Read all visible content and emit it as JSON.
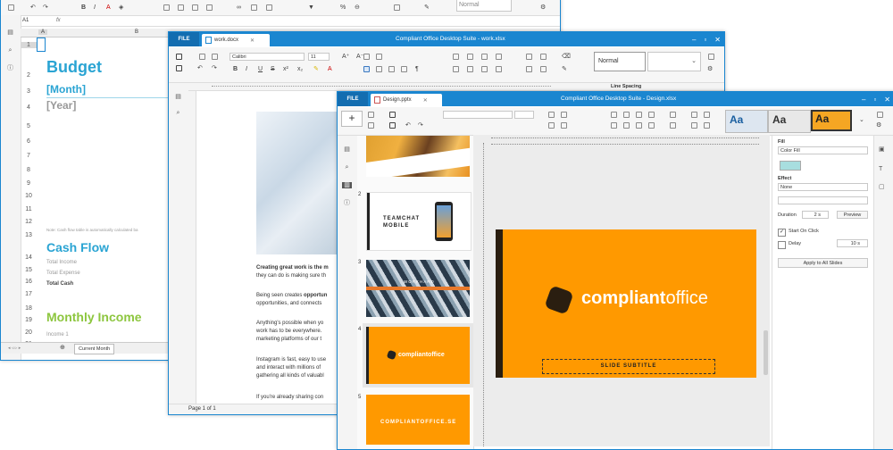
{
  "spreadsheet": {
    "name_box": "A1",
    "formula_prefix": "fx",
    "style_box": "Normal",
    "col_headers": [
      "A",
      "B"
    ],
    "rows": [
      "1",
      "2",
      "3",
      "4",
      "5",
      "6",
      "7",
      "8",
      "9",
      "10",
      "11",
      "12",
      "13",
      "14",
      "15",
      "16",
      "17",
      "18",
      "19",
      "20",
      "21"
    ],
    "title": "Budget",
    "month": "[Month]",
    "year": "[Year]",
    "note": "Note: Cash flow table is automatically calculated ba",
    "cash_flow": "Cash Flow",
    "total_income": "Total Income",
    "total_expense": "Total Expense",
    "total_cash": "Total Cash",
    "monthly_income": "Monthly Income",
    "income_1": "Income 1",
    "sheet_tab": "Current Month"
  },
  "document": {
    "file_label": "FILE",
    "tab_name": "work.docx",
    "window_title": "Compliant Office Desktop Suite - work.xlsx",
    "font_name": "Calibri",
    "font_size": "11",
    "style_name": "Normal",
    "line_spacing_label": "Line Spacing",
    "status": "Page 1 of 1",
    "p1_bold": "Creating great work is the m",
    "p1_rest": "they can do is making sure th",
    "p2_a": "Being seen creates ",
    "p2_b": "opportun",
    "p2_c": "opportunities, and connects",
    "p3_a": "Anything's possible when yo",
    "p3_b": "work has to be everywhere.",
    "p3_c": "marketing platforms of our t",
    "p4_a": "Instagram is fast, easy to use",
    "p4_b": "and interact with millions of",
    "p4_c": "gathering all kinds of valuabl",
    "p5_a": "If you're already sharing con"
  },
  "presentation": {
    "file_label": "FILE",
    "tab_name": "Design.pptx",
    "window_title": "Compliant Office Desktop Suite - Design.xlsx",
    "theme_label": "Aa",
    "slide_numbers": [
      "2",
      "3",
      "4",
      "5"
    ],
    "thumb2_text": "TEAMCHAT\nMOBILE",
    "thumb2_line1": "TEAMCHAT",
    "thumb2_line2": "MOBILE",
    "thumb3_text": "WORKHARD",
    "thumb4_logo": "compliantoffice",
    "thumb5_text": "COMPLIANTOFFICE.SE",
    "slide_logo_a": "compliant",
    "slide_logo_b": "office",
    "slide_subtitle": "SLIDE SUBTITLE",
    "fill_label": "Fill",
    "fill_value": "Color Fill",
    "effect_label": "Effect",
    "effect_value": "None",
    "duration_label": "Duration",
    "duration_value": "2 s",
    "preview_label": "Preview",
    "start_on_click": "Start On Click",
    "delay_label": "Delay",
    "delay_value": "10 s",
    "apply_all": "Apply to All Slides",
    "accent": "#ff9900",
    "fill_swatch": "#a8dedf"
  }
}
